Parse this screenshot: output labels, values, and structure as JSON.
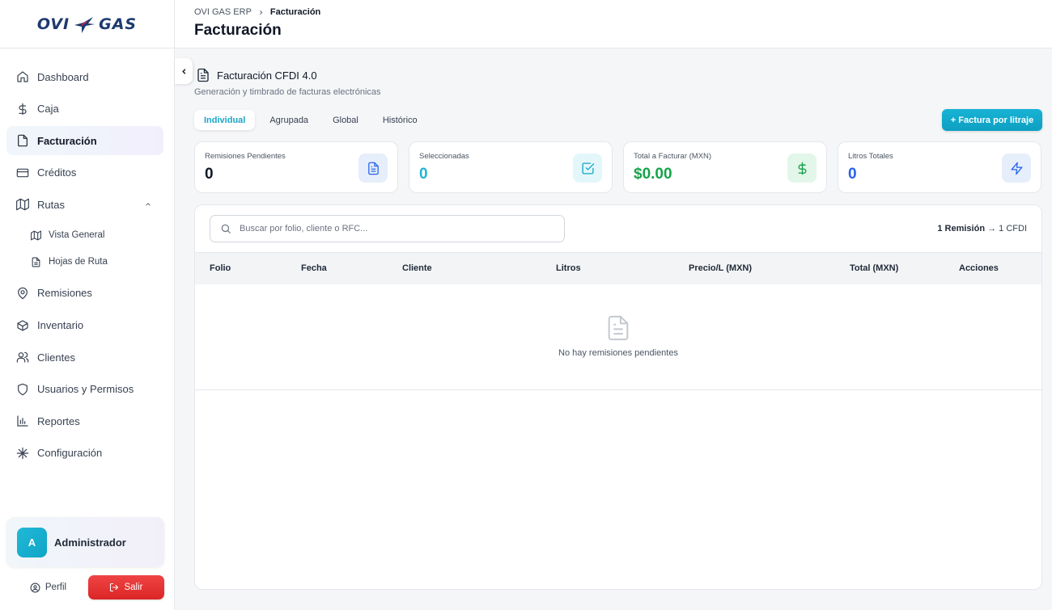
{
  "brand": {
    "logo_left": "OVI",
    "logo_right": "GAS"
  },
  "sidebar": {
    "items": [
      {
        "label": "Dashboard",
        "icon": "home-icon"
      },
      {
        "label": "Caja",
        "icon": "dollar-icon"
      },
      {
        "label": "Facturación",
        "icon": "file-icon",
        "active": true
      },
      {
        "label": "Créditos",
        "icon": "credit-card-icon"
      },
      {
        "label": "Rutas",
        "icon": "map-icon",
        "expanded": true
      }
    ],
    "subitems": [
      {
        "label": "Vista General",
        "icon": "map-icon"
      },
      {
        "label": "Hojas de Ruta",
        "icon": "file-text-icon"
      }
    ],
    "items_after": [
      {
        "label": "Remisiones",
        "icon": "map-pin-icon"
      },
      {
        "label": "Inventario",
        "icon": "box-icon"
      },
      {
        "label": "Clientes",
        "icon": "users-icon"
      },
      {
        "label": "Usuarios y Permisos",
        "icon": "shield-icon"
      },
      {
        "label": "Reportes",
        "icon": "bar-chart-icon"
      },
      {
        "label": "Configuración",
        "icon": "asterisk-icon"
      }
    ],
    "user": {
      "initial": "A",
      "name": "Administrador"
    },
    "profile_label": "Perfil",
    "logout_label": "Salir"
  },
  "header": {
    "breadcrumb_root": "OVI GAS ERP",
    "breadcrumb_current": "Facturación",
    "title": "Facturación"
  },
  "section": {
    "title": "Facturación CFDI 4.0",
    "subtitle": "Generación y timbrado de facturas electrónicas"
  },
  "tabs": [
    "Individual",
    "Agrupada",
    "Global",
    "Histórico"
  ],
  "active_tab": "Individual",
  "action_button": "+ Factura por litraje",
  "stats": [
    {
      "label": "Remisiones Pendientes",
      "value": "0",
      "color": "#111827",
      "icon": "file-text-icon",
      "icon_bg": "#e6eefb",
      "icon_color": "#2563eb"
    },
    {
      "label": "Seleccionadas",
      "value": "0",
      "color": "#22b3cf",
      "icon": "check-square-icon",
      "icon_bg": "#e3f7fa",
      "icon_color": "#14a5c4"
    },
    {
      "label": "Total a Facturar (MXN)",
      "value": "$0.00",
      "color": "#16a34a",
      "icon": "dollar-icon",
      "icon_bg": "#e3f6ea",
      "icon_color": "#16a34a"
    },
    {
      "label": "Litros Totales",
      "value": "0",
      "color": "#2563eb",
      "icon": "zap-icon",
      "icon_bg": "#e6eefb",
      "icon_color": "#2563eb"
    }
  ],
  "table": {
    "search_placeholder": "Buscar por folio, cliente o RFC...",
    "summary_bold": "1 Remisión",
    "summary_rest": " → 1 CFDI",
    "columns": [
      "Folio",
      "Fecha",
      "Cliente",
      "Litros",
      "Precio/L (MXN)",
      "Total (MXN)",
      "Acciones"
    ],
    "empty_text": "No hay remisiones pendientes"
  }
}
